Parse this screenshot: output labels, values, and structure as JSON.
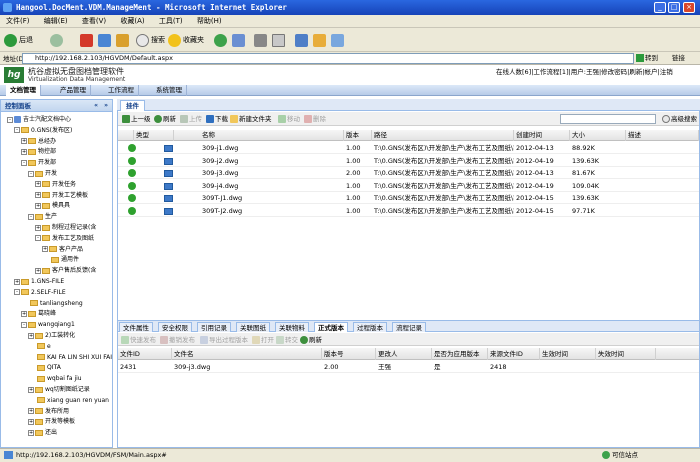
{
  "window": {
    "title": "Hangool.DocMent.VDM.ManageMent - Microsoft Internet Explorer",
    "menu": [
      "文件(F)",
      "编辑(E)",
      "查看(V)",
      "收藏(A)",
      "工具(T)",
      "帮助(H)"
    ],
    "toolbar": {
      "back": "后退",
      "search": "搜索",
      "favorites": "收藏夹"
    },
    "address_label": "地址(D)",
    "address": "http://192.168.2.103/HGVDM/Default.aspx",
    "go_label": "转到",
    "links_label": "链接",
    "status": "http://192.168.2.103/HGVDM/FSM/Main.aspx#",
    "zone": "可信站点"
  },
  "app": {
    "logo": "hg",
    "name": "杭谷虚拟无盘图档管理软件",
    "subtitle": "Virtualization Data Management",
    "user_links": "在线人数[6]|工作流程[1]|用户:王强|修改密码|刷新|帐户|注销",
    "nav": [
      "文档管理",
      "产品管理",
      "工作流程",
      "系统管理"
    ]
  },
  "left_panel": {
    "title": "控制面板",
    "tree": [
      {
        "label": "吉士汽配文档中心",
        "depth": 0,
        "toggle": "-"
      },
      {
        "label": "0.GNS(发布区)",
        "depth": 1,
        "toggle": "-"
      },
      {
        "label": "总经办",
        "depth": 2,
        "toggle": "+"
      },
      {
        "label": "物控部",
        "depth": 2,
        "toggle": "+"
      },
      {
        "label": "开发部",
        "depth": 2,
        "toggle": "-"
      },
      {
        "label": "开发",
        "depth": 3,
        "toggle": "-"
      },
      {
        "label": "开发任务",
        "depth": 4,
        "toggle": "+"
      },
      {
        "label": "开发工艺模板",
        "depth": 4,
        "toggle": "+"
      },
      {
        "label": "模具具",
        "depth": 4,
        "toggle": "+"
      },
      {
        "label": "生产",
        "depth": 3,
        "toggle": "-"
      },
      {
        "label": "制程过程记录(含",
        "depth": 4,
        "toggle": "+"
      },
      {
        "label": "发布工艺及图纸",
        "depth": 4,
        "toggle": "-"
      },
      {
        "label": "客户产品",
        "depth": 5,
        "toggle": "+"
      },
      {
        "label": "通用件",
        "depth": 5,
        "toggle": ""
      },
      {
        "label": "客户售后反馈(含",
        "depth": 4,
        "toggle": "+"
      },
      {
        "label": "1.GNS-FILE",
        "depth": 1,
        "toggle": "+"
      },
      {
        "label": "2.SELF-FILE",
        "depth": 1,
        "toggle": "-"
      },
      {
        "label": "tanliangsheng",
        "depth": 2,
        "toggle": ""
      },
      {
        "label": "葛晓峰",
        "depth": 2,
        "toggle": "+"
      },
      {
        "label": "wangqiang1",
        "depth": 2,
        "toggle": "-"
      },
      {
        "label": "2)工装转化",
        "depth": 3,
        "toggle": "+"
      },
      {
        "label": "e",
        "depth": 3,
        "toggle": ""
      },
      {
        "label": "KAI FA LIN SHI XUI FAI",
        "depth": 3,
        "toggle": ""
      },
      {
        "label": "QITA",
        "depth": 3,
        "toggle": ""
      },
      {
        "label": "wqbai fa jiu",
        "depth": 3,
        "toggle": ""
      },
      {
        "label": "wq切割图纸记录",
        "depth": 3,
        "toggle": "+"
      },
      {
        "label": "xiang guan ren yuan",
        "depth": 3,
        "toggle": ""
      },
      {
        "label": "发布所用",
        "depth": 3,
        "toggle": "+"
      },
      {
        "label": "开发等模板",
        "depth": 3,
        "toggle": "+"
      },
      {
        "label": "还出",
        "depth": 3,
        "toggle": "+"
      }
    ]
  },
  "main": {
    "tab": "挂件",
    "toolbar": [
      "上一级",
      "刷新",
      "上传",
      "下载",
      "新建文件夹",
      "移动",
      "删除"
    ],
    "toolbar_disabled": [
      false,
      false,
      true,
      false,
      false,
      true,
      true
    ],
    "search_label": "高级搜索",
    "columns": [
      "类型",
      "名称",
      "版本",
      "路径",
      "创建时间",
      "大小",
      "描述"
    ],
    "rows": [
      {
        "name": "309-j1.dwg",
        "version": "1.00",
        "path": "T:\\0.GNS(发布区)\\开发部\\生产\\发布工艺及图纸\\客",
        "created": "2012-04-13",
        "size": "88.92K"
      },
      {
        "name": "309-j2.dwg",
        "version": "1.00",
        "path": "T:\\0.GNS(发布区)\\开发部\\生产\\发布工艺及图纸\\客",
        "created": "2012-04-19",
        "size": "139.63K"
      },
      {
        "name": "309-j3.dwg",
        "version": "2.00",
        "path": "T:\\0.GNS(发布区)\\开发部\\生产\\发布工艺及图纸\\客",
        "created": "2012-04-13",
        "size": "81.67K"
      },
      {
        "name": "309-j4.dwg",
        "version": "1.00",
        "path": "T:\\0.GNS(发布区)\\开发部\\生产\\发布工艺及图纸\\客",
        "created": "2012-04-19",
        "size": "109.04K"
      },
      {
        "name": "309T-J1.dwg",
        "version": "1.00",
        "path": "T:\\0.GNS(发布区)\\开发部\\生产\\发布工艺及图纸\\客",
        "created": "2012-04-15",
        "size": "139.63K"
      },
      {
        "name": "309T-J2.dwg",
        "version": "1.00",
        "path": "T:\\0.GNS(发布区)\\开发部\\生产\\发布工艺及图纸\\客",
        "created": "2012-04-15",
        "size": "97.71K"
      }
    ]
  },
  "detail": {
    "tabs": [
      "文件属性",
      "安全权限",
      "引用记录",
      "关联图纸",
      "关联物料",
      "正式版本",
      "过程版本",
      "流程记录"
    ],
    "active_tab": 5,
    "toolbar": [
      "快速发布",
      "撤销发布",
      "导出过程版本",
      "打开",
      "转交",
      "刷新"
    ],
    "toolbar_disabled": [
      true,
      true,
      true,
      true,
      true,
      false
    ],
    "columns": [
      "文件ID",
      "文件名",
      "版本号",
      "更改人",
      "是否为应用版本",
      "来源文件ID",
      "生效时间",
      "失效时间"
    ],
    "rows": [
      {
        "id": "2431",
        "name": "309-j3.dwg",
        "version": "2.00",
        "changer": "王强",
        "applied": "是",
        "source": "2418",
        "effective": "",
        "expire": ""
      }
    ]
  }
}
